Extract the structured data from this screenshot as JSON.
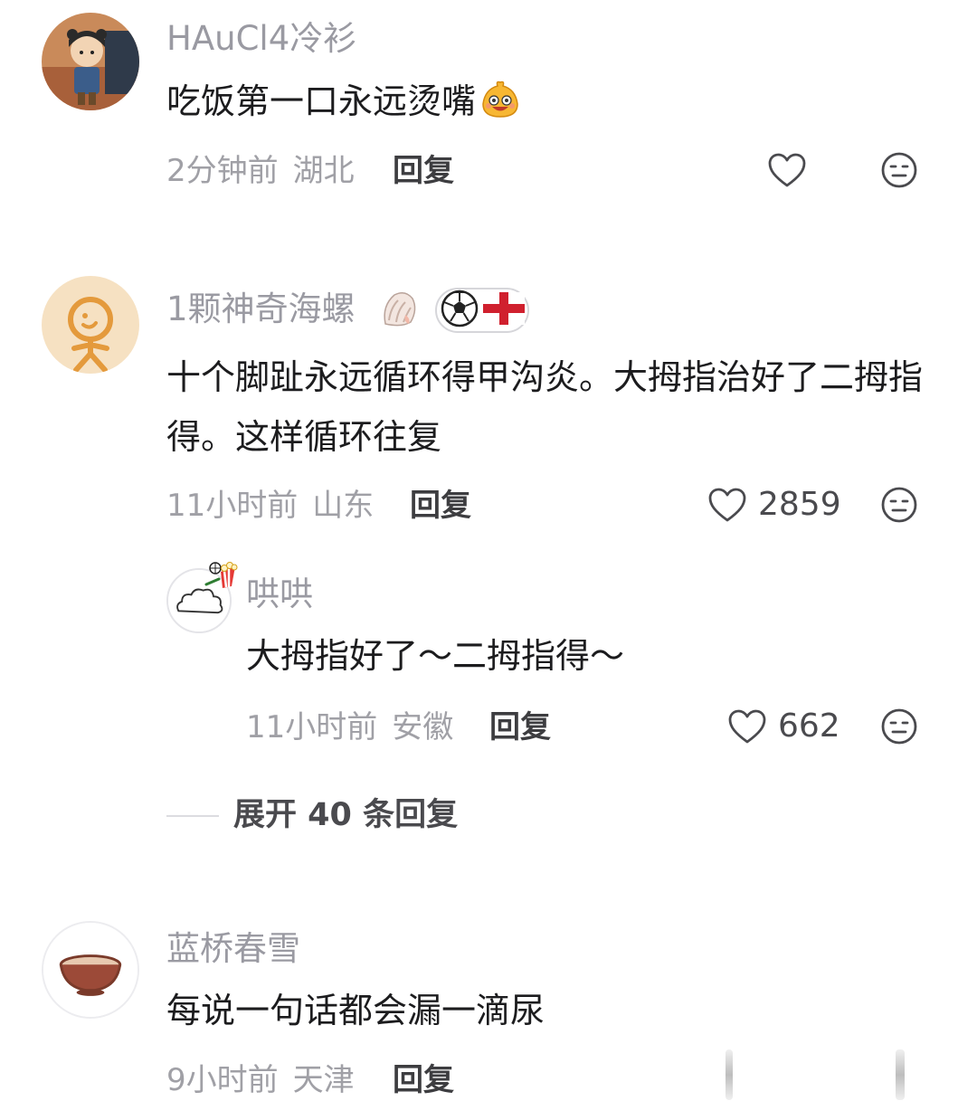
{
  "comments": [
    {
      "username": "HAuCl4冷衫",
      "content": "吃饭第一口永远烫嘴",
      "time": "2分钟前",
      "location": "湖北",
      "reply_label": "回复",
      "likes": ""
    },
    {
      "username": "1颗神奇海螺",
      "content": "十个脚趾永远循环得甲沟炎。大拇指治好了二拇指得。这样循环往复",
      "time": "11小时前",
      "location": "山东",
      "reply_label": "回复",
      "likes": "2859",
      "replies": [
        {
          "username": "哄哄",
          "content": "大拇指好了～二拇指得～",
          "time": "11小时前",
          "location": "安徽",
          "reply_label": "回复",
          "likes": "662"
        }
      ],
      "expand_label": "展开 40 条回复"
    },
    {
      "username": "蓝桥春雪",
      "content": "每说一句话都会漏一滴尿",
      "time": "9小时前",
      "location": "天津",
      "reply_label": "回复",
      "likes": ""
    }
  ],
  "icons": {
    "like": "heart-outline-icon",
    "dislike": "meh-face-icon",
    "emoji": "grin-blob-emoji",
    "conch": "conch-shell-emoji",
    "soccer": "soccer-ball-icon",
    "england": "england-flag-icon",
    "popcorn": "popcorn-emoji"
  },
  "colors": {
    "username": "#9a9aa2",
    "content": "#1c1c1e",
    "meta": "#a0a0a6",
    "reply": "#3d3d40",
    "icon": "#4a4a4e"
  }
}
